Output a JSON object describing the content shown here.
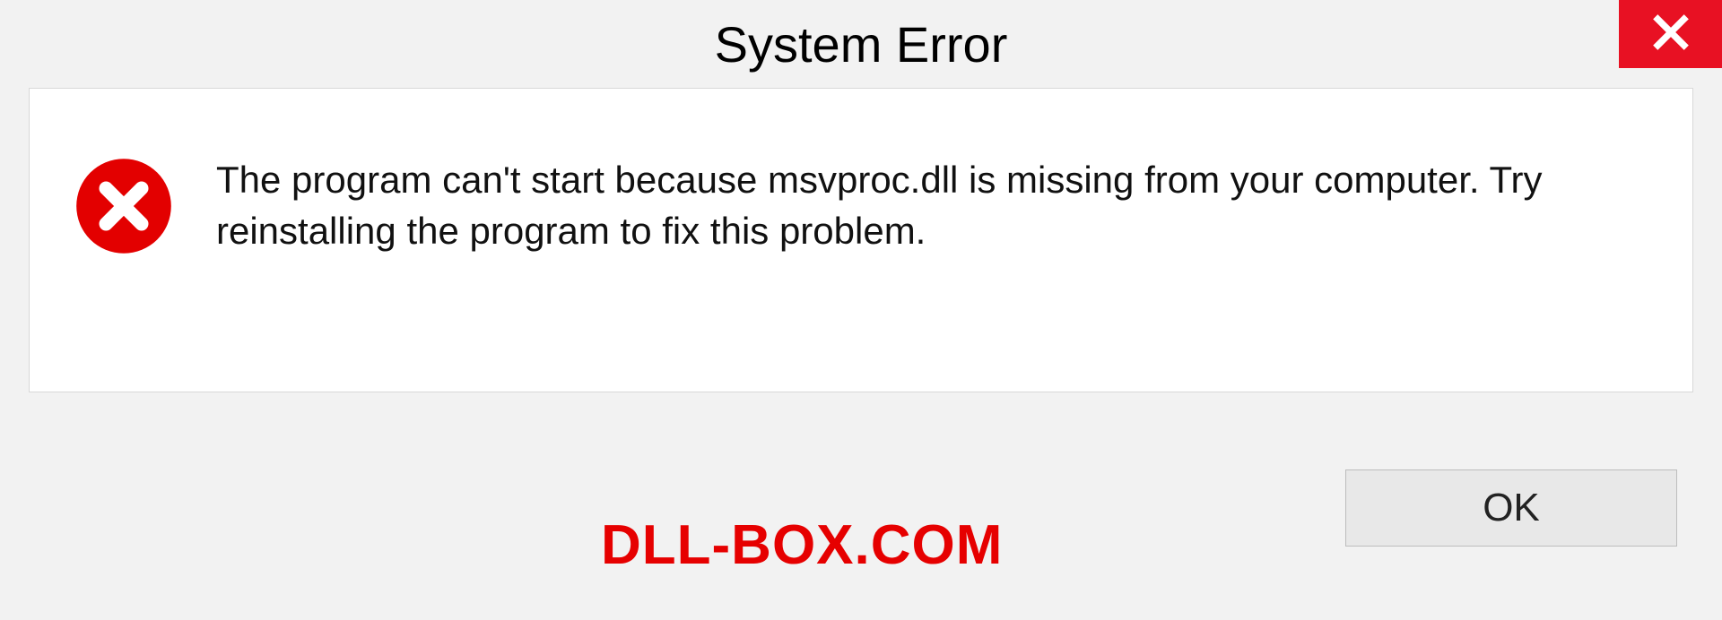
{
  "titlebar": {
    "title": "System Error"
  },
  "dialog": {
    "message": "The program can't start because msvproc.dll is missing from your computer. Try reinstalling the program to fix this problem."
  },
  "footer": {
    "brand": "DLL-BOX.COM",
    "ok_label": "OK"
  },
  "icons": {
    "close": "close-icon",
    "error": "error-icon"
  },
  "colors": {
    "close_bg": "#e81123",
    "error_fill": "#e30000",
    "brand": "#e60000"
  }
}
